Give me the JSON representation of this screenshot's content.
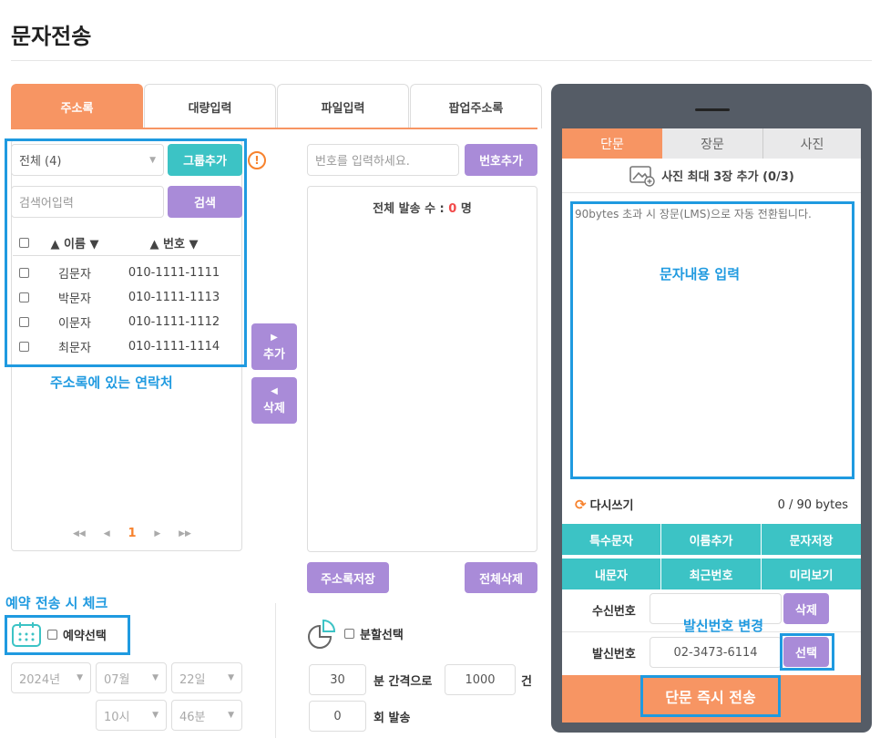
{
  "page": {
    "title": "문자전송"
  },
  "tabs": [
    {
      "label": "주소록",
      "active": true
    },
    {
      "label": "대량입력",
      "active": false
    },
    {
      "label": "파일입력",
      "active": false
    },
    {
      "label": "팝업주소록",
      "active": false
    }
  ],
  "address_book": {
    "group_select": "전체 (4)",
    "group_add_button": "그룹추가",
    "info_icon": "!",
    "search_placeholder": "검색어입력",
    "search_button": "검색",
    "columns": {
      "name": "▲ 이름 ▼",
      "number": "▲ 번호 ▼"
    },
    "rows": [
      {
        "name": "김문자",
        "number": "010-1111-1111"
      },
      {
        "name": "박문자",
        "number": "010-1111-1113"
      },
      {
        "name": "이문자",
        "number": "010-1111-1112"
      },
      {
        "name": "최문자",
        "number": "010-1111-1114"
      }
    ],
    "annotation": "주소록에 있는 연락처",
    "pagination": {
      "first": "◀◀",
      "prev": "◀",
      "current": "1",
      "next": "▶",
      "last": "▶▶"
    }
  },
  "transfer": {
    "add_arrow": "▶",
    "add_label": "추가",
    "delete_arrow": "◀",
    "delete_label": "삭제"
  },
  "recipients": {
    "number_placeholder": "번호를 입력하세요.",
    "number_add_button": "번호추가",
    "total_label": "전체 발송 수 : ",
    "total_count": "0",
    "total_unit": " 명",
    "save_button": "주소록저장",
    "delete_all_button": "전체삭제"
  },
  "reservation": {
    "annotation": "예약 전송 시 체크",
    "checkbox_label": "예약선택",
    "year": "2024년",
    "month": "07월",
    "day": "22일",
    "hour": "10시",
    "minute": "46분"
  },
  "split": {
    "checkbox_label": "분할선택",
    "interval_value": "30",
    "interval_label": "분 간격으로",
    "count_value": "1000",
    "count_label": "건",
    "repeat_value": "0",
    "repeat_label": "회 발송"
  },
  "phone": {
    "tabs": [
      {
        "label": "단문",
        "active": true
      },
      {
        "label": "장문",
        "active": false
      },
      {
        "label": "사진",
        "active": false
      }
    ],
    "photo_add": "사진 최대 3장 추가 (0/3)",
    "message_hint": "90bytes 초과 시 장문(LMS)으로 자동 전환됩니다.",
    "message_annotation": "문자내용 입력",
    "rewrite": "다시쓰기",
    "byte_count": "0 / 90 bytes",
    "buttons": [
      "특수문자",
      "이름추가",
      "문자저장",
      "내문자",
      "최근번호",
      "미리보기"
    ],
    "receiver_label": "수신번호",
    "receiver_value": "",
    "receiver_delete": "삭제",
    "sender_annotation": "발신번호 변경",
    "sender_label": "발신번호",
    "sender_value": "02-3473-6114",
    "sender_select": "선택",
    "send_button": "단문 즉시 전송"
  },
  "colors": {
    "accent_orange": "#f79563",
    "teal": "#3cc3c5",
    "purple": "#a98bd8",
    "highlight_blue": "#1f9ae0",
    "phone_frame": "#555c66"
  }
}
